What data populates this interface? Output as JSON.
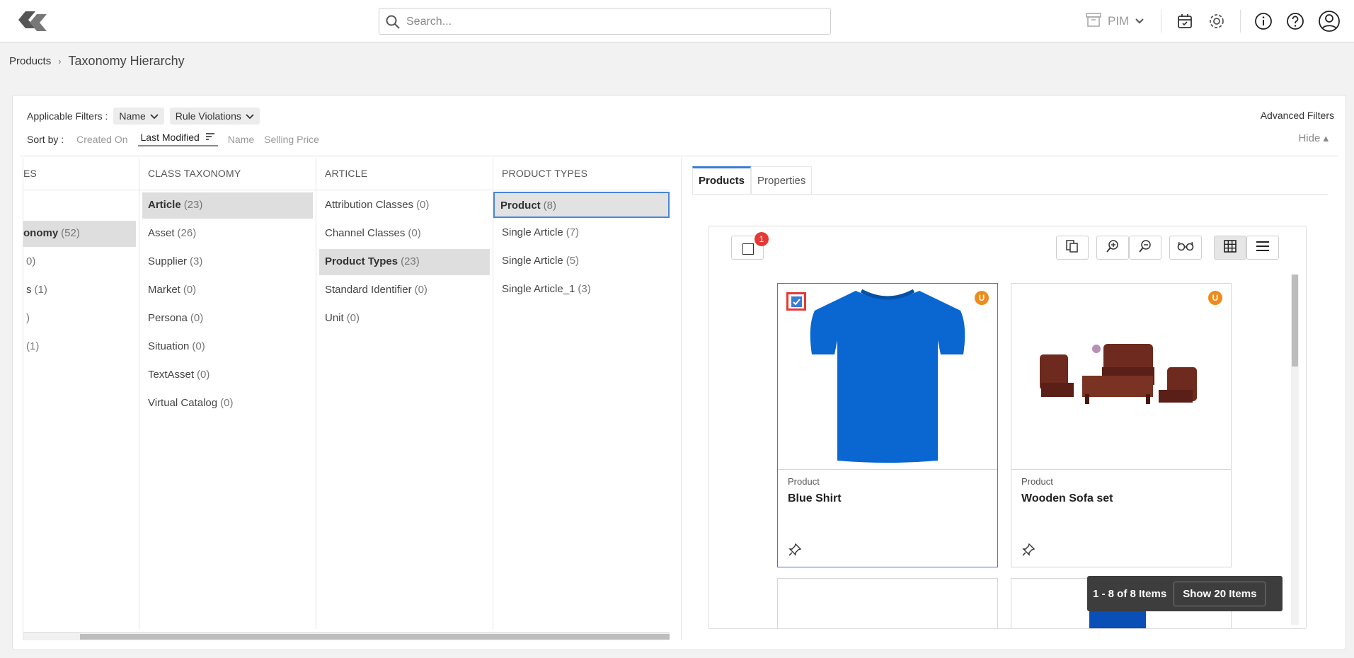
{
  "header": {
    "search_placeholder": "Search...",
    "app_switch_label": "PIM"
  },
  "breadcrumb": {
    "root": "Products",
    "current": "Taxonomy Hierarchy"
  },
  "filters": {
    "label": "Applicable Filters :",
    "chips": [
      "Name",
      "Rule Violations"
    ],
    "advanced": "Advanced Filters",
    "hide": "Hide ▴"
  },
  "sort": {
    "label": "Sort by :",
    "options": [
      "Created On",
      "Last Modified",
      "Name",
      "Selling Price"
    ],
    "active": "Last Modified"
  },
  "columns": [
    {
      "header": "ES",
      "items": [
        {
          "name": "",
          "count": ""
        },
        {
          "name": "onomy",
          "count": "(52)"
        },
        {
          "name": "",
          "count": "0)"
        },
        {
          "name": "s",
          "count": "(1)"
        },
        {
          "name": "",
          "count": ")"
        },
        {
          "name": "",
          "count": "(1)"
        }
      ]
    },
    {
      "header": "CLASS TAXONOMY",
      "items": [
        {
          "name": "Article",
          "count": "(23)"
        },
        {
          "name": "Asset",
          "count": "(26)"
        },
        {
          "name": "Supplier",
          "count": "(3)"
        },
        {
          "name": "Market",
          "count": "(0)"
        },
        {
          "name": "Persona",
          "count": "(0)"
        },
        {
          "name": "Situation",
          "count": "(0)"
        },
        {
          "name": "TextAsset",
          "count": "(0)"
        },
        {
          "name": "Virtual Catalog",
          "count": "(0)"
        }
      ]
    },
    {
      "header": "ARTICLE",
      "items": [
        {
          "name": "Attribution Classes",
          "count": "(0)"
        },
        {
          "name": "Channel Classes",
          "count": "(0)"
        },
        {
          "name": "Product Types",
          "count": "(23)"
        },
        {
          "name": "Standard Identifier",
          "count": "(0)"
        },
        {
          "name": "Unit",
          "count": "(0)"
        }
      ]
    },
    {
      "header": "PRODUCT TYPES",
      "items": [
        {
          "name": "Product",
          "count": "(8)"
        },
        {
          "name": "Single Article",
          "count": "(7)"
        },
        {
          "name": "Single Article",
          "count": "(5)"
        },
        {
          "name": "Single Article_1",
          "count": "(3)"
        }
      ]
    }
  ],
  "right_pane": {
    "tabs": [
      "Products",
      "Properties"
    ],
    "selected_count": "1",
    "cards": [
      {
        "type": "Product",
        "name": "Blue Shirt",
        "status": "U",
        "selected": true
      },
      {
        "type": "Product",
        "name": "Wooden Sofa set",
        "status": "U",
        "selected": false
      }
    ],
    "pager": {
      "range": "1 - 8 of 8 Items",
      "show": "Show 20 Items"
    }
  },
  "colors": {
    "accent": "#3a7bd5",
    "badge_red": "#e53935",
    "status_orange": "#ef8a1c"
  }
}
